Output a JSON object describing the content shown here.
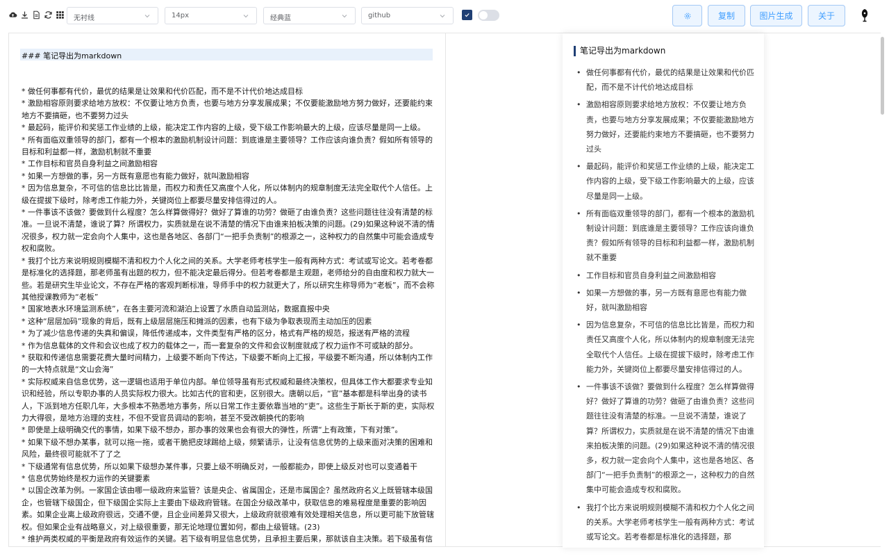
{
  "toolbar": {
    "icons": [
      "cloud-upload-icon",
      "download-icon",
      "document-icon",
      "refresh-icon",
      "grid-icon"
    ],
    "selects": {
      "wireframe": "无衬线",
      "font_size": "14px",
      "theme": "经典蓝",
      "code_theme": "github"
    },
    "checkbox_checked": true,
    "toggle_on": false,
    "buttons": {
      "settings_icon": "gear-icon",
      "copy": "复制",
      "image_gen": "图片生成",
      "about": "关于"
    },
    "accent": "#1f3f74",
    "button_color": "#409eff"
  },
  "editor": {
    "heading": "### 笔记导出为markdown",
    "lines": [
      "* 做任何事都有代价，最优的结果是让效果和代价匹配，而不是不计代价地达成目标",
      "* 激励相容原则要求给地方放权：不仅要让地方负责，也要与地方分享发展成果；不仅要能激励地方努力做好，还要能约束地方不要搞砸，也不要努力过头",
      "* 最起码，能评价和奖惩工作业绩的上级，能决定工作内容的上级，受下级工作影响最大的上级，应该尽量是同一上级。",
      "* 所有面临双重领导的部门，都有一个根本的激励机制设计问题：到底谁是主要领导？工作应该向谁负责？假如所有领导的目标和利益都一样，激励机制就不重要",
      "* 工作目标和官员自身利益之间激励相容",
      "* 如果一方想做的事，另一方既有意愿也有能力做好，就叫激励相容",
      "* 因为信息复杂，不可信的信息比比皆是，而权力和责任又高度个人化，所以体制内的规章制度无法完全取代个人信任。上级在提拔下级时，除考虑工作能力外，关键岗位上都要尽量安排信得过的人。",
      "* 一件事该不该做？要做到什么程度？怎么样算做得好？做好了算谁的功劳？做砸了由谁负责？这些问题往往没有清楚的标准。一旦说不清楚，谁说了算？所谓权力，实质就是在说不清楚的情况下由谁来拍板决策的问题。(29)如果这种说不清的情况很多，权力就一定会向个人集中，这也是各地区、各部门“一把手负责制”的根源之一，这种权力的自然集中可能会造成专权和腐败。",
      "* 我打个比方来说明规则模糊不清和权力个人化之间的关系。大学老师考核学生一般有两种方式：考试或写论文。若考卷都是标准化的选择题，那老师虽有出题的权力，但不能决定最后得分。但若考卷都是主观题，老师给分的自由度和权力就大一些。若是研究生毕业论文，不存在严格的客观判断标准，导师手中的权力就更大了，所以研究生称导师为“老板”，而不会称其他授课教师为“老板”",
      "* 国家地表水环境监测系统”，在各主要河流和湖泊上设置了水质自动监测站，数据直报中央",
      "* 这种“层层加码”现象的背后，既有上级层层施压和摊派的因素，也有下级为争取表现而主动加压的因素",
      "* 为了减少信息传递的失真和偏误，降低传递成本，文件类型有严格的区分，格式有严格的规范，报送有严格的流程",
      "* 作为信息载体的文件和会议也成了权力的载体之一，而一套复杂的文件和会议制度就成了权力运作不可或缺的部分。",
      "* 获取和传递信息需要花费大量时间精力，上级要不断向下传达，下级要不断向上汇报，平级要不断沟通，所以体制内工作的一大特点就是“文山会海”",
      "* 实际权威来自信息优势，这一逻辑也适用于单位内部。单位领导虽有形式权威和最终决策权，但具体工作大都要求专业知识和经验，所以专职办事的人员实际权力很大。比如古代的官和吏，区别很大。唐朝以后，“官”基本都是科举出身的读书人，下派到地方任职几年，大多根本不熟悉地方事务，所以日常工作主要依靠当地的“吏”。这些生于斯长于斯的吏，实际权力大得很，是地方治理的支柱，不但不受官员调动的影响，甚至不受改朝换代的影响",
      "* 即使是上级明确交代的事情，如果下级不想办，那办事的效果也会有很大的弹性，所谓“上有政策，下有对策”。",
      "* 如果下级不想办某事，就可以拖一拖，或者干脆把皮球踢给上级，频繁请示，让没有信息优势的上级来面对决策的困难和风险，最终很可能就不了了之",
      "* 下级通常有信息优势，所以如果下级想办某件事，只要上级不明确反对，一般都能办，即使上级反对也可以变通着干",
      "* 信息优势始终是权力运作的关键要素",
      "* 以国企改革为例。一家国企该由哪一级政府来监管？该是央企、省属国企，还是市属国企？虽然政府名义上既管辖本级国企，也管辖下级国企，但下级国企实际上主要由下级政府管辖。在国企分级改革中，获取信息的难易程度是重要的影响因素。如果企业离上级政府很远，交通不便，且企业间差异又很大，上级政府就很难有效处理相关信息，所以更可能下放管辖权。但如果企业有战略意义，对上级很重要，那无论地理位置如何，都由上级管辖。(23)",
      "* 维护两类权威的平衡是政府有效运作的关键。若下级有明显信息优势，且承担主要后果，那就该自主决策。若下级虽有信"
    ]
  },
  "preview": {
    "title": "笔记导出为markdown",
    "items": [
      "做任何事都有代价，最优的结果是让效果和代价匹配，而不是不计代价地达成目标",
      "激励相容原则要求给地方放权：不仅要让地方负责，也要与地方分享发展成果；不仅要能激励地方努力做好，还要能约束地方不要搞砸，也不要努力过头",
      "最起码，能评价和奖惩工作业绩的上级，能决定工作内容的上级，受下级工作影响最大的上级，应该尽量是同一上级。",
      "所有面临双重领导的部门，都有一个根本的激励机制设计问题：到底谁是主要领导？工作应该向谁负责？假如所有领导的目标和利益都一样，激励机制就不重要",
      "工作目标和官员自身利益之间激励相容",
      "如果一方想做的事，另一方既有意愿也有能力做好，就叫激励相容",
      "因为信息复杂，不可信的信息比比皆是，而权力和责任又高度个人化，所以体制内的规章制度无法完全取代个人信任。上级在提拔下级时，除考虑工作能力外，关键岗位上都要尽量安排信得过的人。",
      "一件事该不该做？要做到什么程度？怎么样算做得好？做好了算谁的功劳？做砸了由谁负责？这些问题往往没有清楚的标准。一旦说不清楚，谁说了算？所谓权力，实质就是在说不清楚的情况下由谁来拍板决策的问题。(29)如果这种说不清的情况很多，权力就一定会向个人集中，这也是各地区、各部门“一把手负责制”的根源之一，这种权力的自然集中可能会造成专权和腐败。",
      "我打个比方来说明规则模糊不清和权力个人化之间的关系。大学老师考核学生一般有两种方式：考试或写论文。若考卷都是标准化的选择题，那"
    ]
  }
}
